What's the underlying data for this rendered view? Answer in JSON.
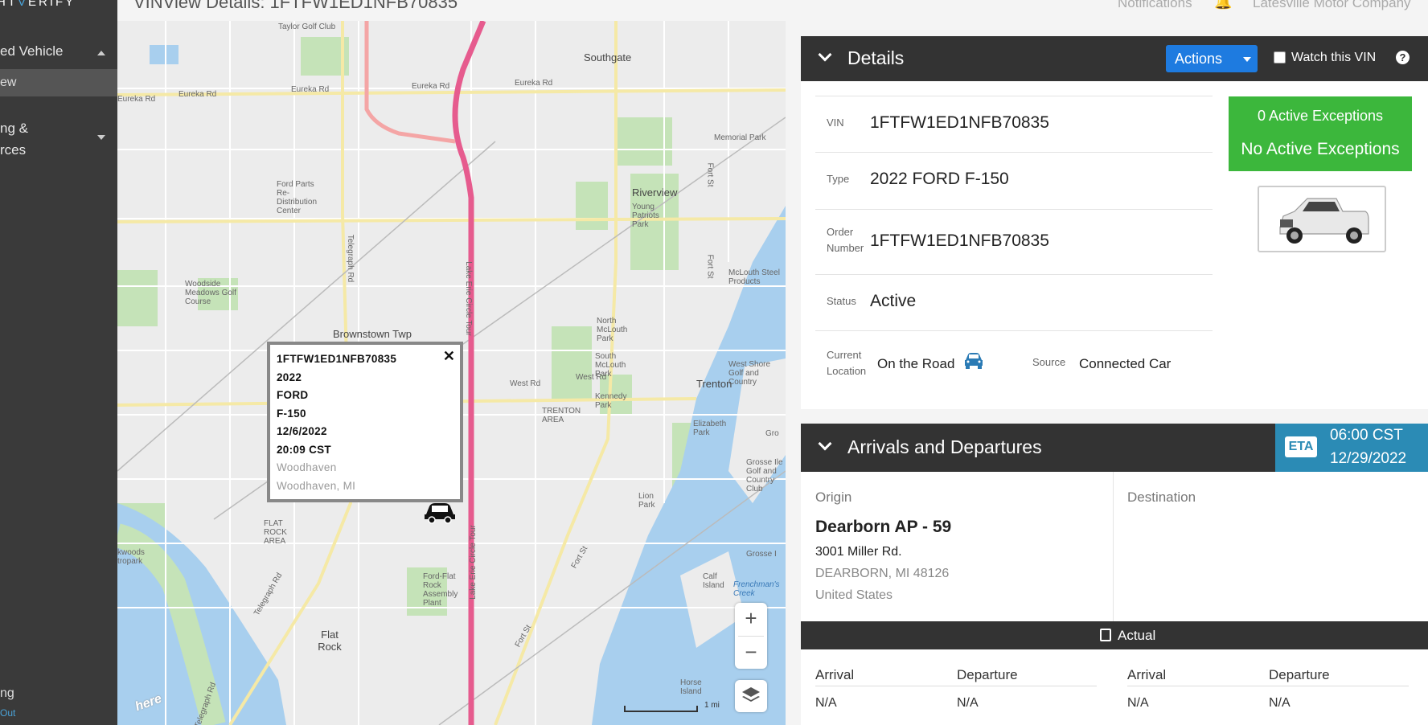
{
  "sidebar": {
    "logo_prefix": "HT",
    "logo_v": "V",
    "logo_suffix": "ERIFY",
    "section1": "ed Vehicle",
    "active_item": "ew",
    "section2_line1": "ng &",
    "section2_line2": "rces",
    "bottom_line1": "ng",
    "bottom_line2": "Out"
  },
  "header": {
    "page_title": "VINView Details: 1FTFW1ED1NFB70835",
    "notifications": "Notifications",
    "company": "Latesville Motor Company"
  },
  "map": {
    "popup": {
      "lines_bold": [
        "1FTFW1ED1NFB70835",
        "2022",
        "FORD",
        "F-150",
        "12/6/2022",
        "20:09 CST"
      ],
      "lines_grey": [
        "Woodhaven",
        "Woodhaven, MI"
      ],
      "close": "✕"
    },
    "labels": {
      "taylor": "Taylor Golf Club",
      "southgate": "Southgate",
      "eureka1": "Eureka Rd",
      "eureka2": "Eureka Rd",
      "eureka3": "Eureka Rd",
      "eureka4": "Eureka Rd",
      "eureka5": "Eureka Rd",
      "memorial": "Memorial Park",
      "fordparts": "Ford Parts Re-Distribution Center",
      "riverview": "Riverview",
      "young": "Young Patriots Park",
      "woodside": "Woodside Meadows Golf Course",
      "mclouth": "McLouth Steel Products",
      "brownstown": "Brownstown Twp",
      "northmc": "North McLouth Park",
      "southmc": "South McLouth Park",
      "westrd": "West Rd",
      "westrd2": "West Rd",
      "trenton": "Trenton",
      "kennedy": "Kennedy Park",
      "trentonarea": "TRENTON AREA",
      "elizabeth": "Elizabeth Park",
      "flatrockarea": "FLAT ROCK AREA",
      "fordflat": "Ford-Flat Rock Assembly Plant",
      "lion": "Lion Park",
      "flatrock": "Flat Rock",
      "grosse": "Grosse Ile Golf and Country Club",
      "grossetxt": "Grosse I",
      "calf": "Calf Island",
      "frenchman": "Frenchman's Creek",
      "horse": "Horse Island",
      "woods": "kwoods tropark",
      "westshore": "West Shore Golf and Country",
      "telegraph1": "Telegraph Rd",
      "telegraph2": "Telegraph Rd",
      "telegraph3": "Telegraph Rd",
      "fortst1": "Fort St",
      "fortst2": "Fort St",
      "fortst3": "Fort St",
      "fortst4": "Fort St",
      "lakeerie1": "Lake Erie Circle Tour",
      "lakeerie2": "Lake Erie Circle Tour",
      "gro": "Gro"
    },
    "scale": "1 mi",
    "here_logo": "here",
    "zoom_in": "+",
    "zoom_out": "−"
  },
  "details": {
    "title": "Details",
    "actions_label": "Actions",
    "watch_label": "Watch this VIN",
    "help": "?",
    "fields": {
      "vin_label": "VIN",
      "vin_value": "1FTFW1ED1NFB70835",
      "type_label": "Type",
      "type_value": "2022 FORD F-150",
      "order_label_1": "Order",
      "order_label_2": "Number",
      "order_value": "1FTFW1ED1NFB70835",
      "status_label": "Status",
      "status_value": "Active",
      "location_label_1": "Current",
      "location_label_2": "Location",
      "location_value": "On the Road",
      "source_label": "Source",
      "source_value": "Connected Car"
    },
    "exceptions": {
      "count_text": "0 Active Exceptions",
      "status_text": "No Active Exceptions",
      "color": "#3cb73c"
    }
  },
  "arrivals": {
    "title": "Arrivals and Departures",
    "eta_badge": "ETA",
    "eta_time": "06:00 CST",
    "eta_date": "12/29/2022",
    "origin_label": "Origin",
    "destination_label": "Destination",
    "origin_name": "Dearborn AP - 59",
    "origin_street": "3001 Miller Rd.",
    "origin_city": "DEARBORN, MI 48126",
    "origin_country": "United States",
    "actual_label": "Actual",
    "left": {
      "arrival_h": "Arrival",
      "departure_h": "Departure",
      "arrival_v": "N/A",
      "departure_v": "N/A"
    },
    "right": {
      "arrival_h": "Arrival",
      "departure_h": "Departure",
      "arrival_v": "N/A",
      "departure_v": "N/A"
    }
  }
}
